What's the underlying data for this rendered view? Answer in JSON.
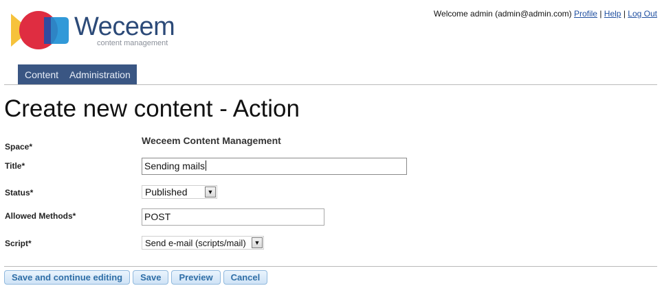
{
  "header": {
    "logo": {
      "title": "Weceem",
      "subtitle": "content management"
    },
    "user_bar": {
      "welcome": "Welcome admin (admin@admin.com)",
      "links": [
        "Profile",
        "Help",
        "Log Out"
      ],
      "separator": "|"
    }
  },
  "nav": {
    "items": [
      "Content",
      "Administration"
    ]
  },
  "page": {
    "title": "Create new content - Action"
  },
  "form": {
    "space": {
      "label": "Space*",
      "value": "Weceem Content Management"
    },
    "title": {
      "label": "Title*",
      "value": "Sending mails"
    },
    "status": {
      "label": "Status*",
      "selected": "Published"
    },
    "allowed_methods": {
      "label": "Allowed Methods*",
      "value": "POST"
    },
    "script": {
      "label": "Script*",
      "selected": "Send e-mail (scripts/mail)"
    }
  },
  "actions": {
    "save_continue": "Save and continue editing",
    "save": "Save",
    "preview": "Preview",
    "cancel": "Cancel"
  },
  "icons": {
    "dropdown": "chevron-down-icon",
    "logo": "weceem-logo-icon"
  },
  "colors": {
    "nav_bg": "#3a5683",
    "logo_text": "#2c4a78",
    "link": "#1f4fa0",
    "button_text": "#2e6ea6",
    "button_bg": "#d9eaf8"
  }
}
